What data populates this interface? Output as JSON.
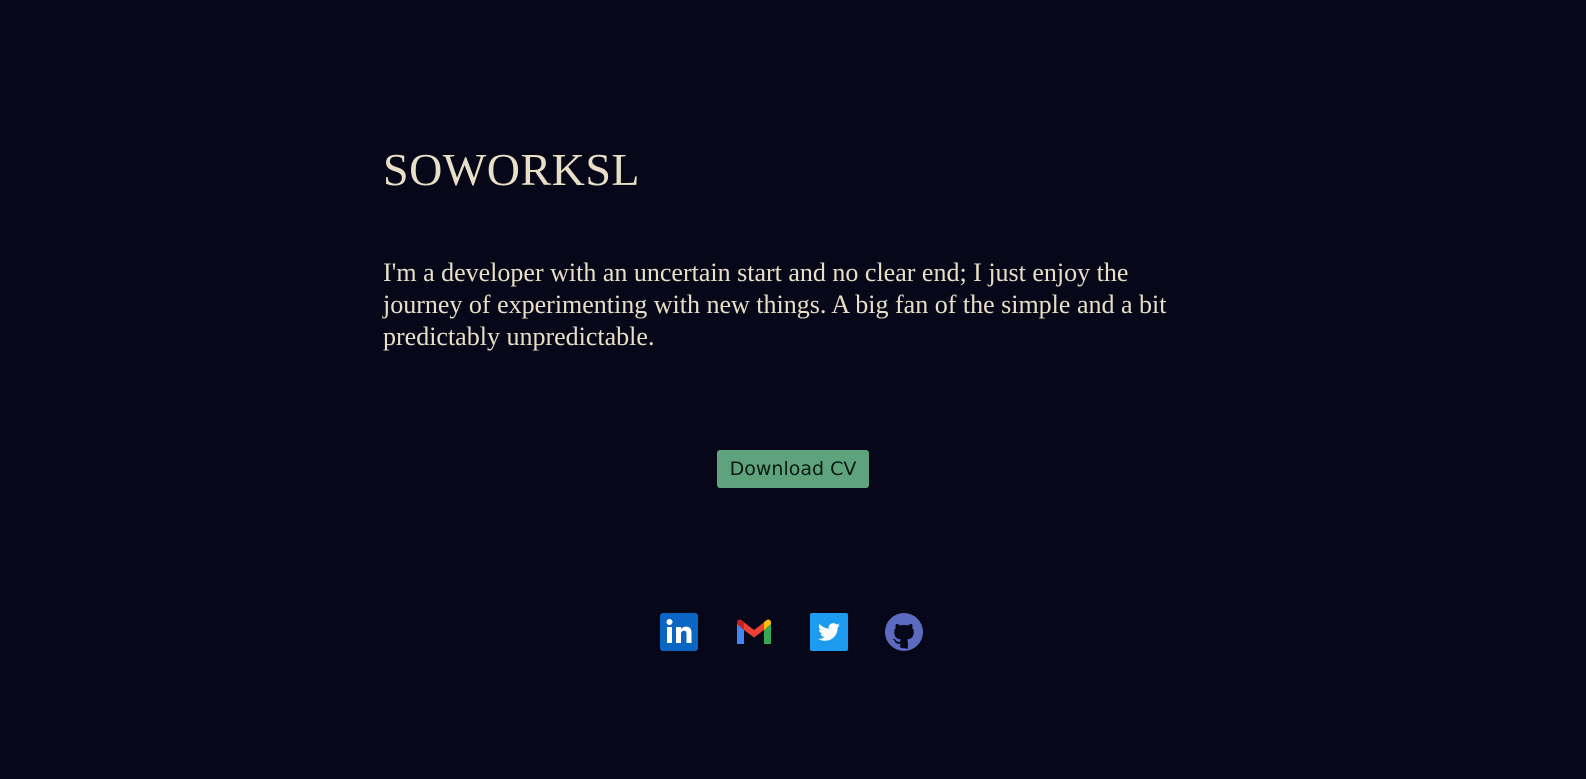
{
  "header": {
    "title": "SOWORKSL"
  },
  "about": {
    "bio": "I'm a developer with an uncertain start and no clear end; I just enjoy the journey of experimenting with new things. A big fan of the simple and a bit predictably unpredictable."
  },
  "actions": {
    "download_cv_label": "Download CV"
  },
  "socials": [
    {
      "icon": "linkedin-icon",
      "color": "#0a66c2"
    },
    {
      "icon": "gmail-icon",
      "color": "#ea4335"
    },
    {
      "icon": "twitter-icon",
      "color": "#1d9bf0"
    },
    {
      "icon": "github-icon",
      "color": "#5c6bc0"
    }
  ],
  "colors": {
    "background": "#07071a",
    "text": "#e8dfc6",
    "button": "#5fa37e"
  }
}
